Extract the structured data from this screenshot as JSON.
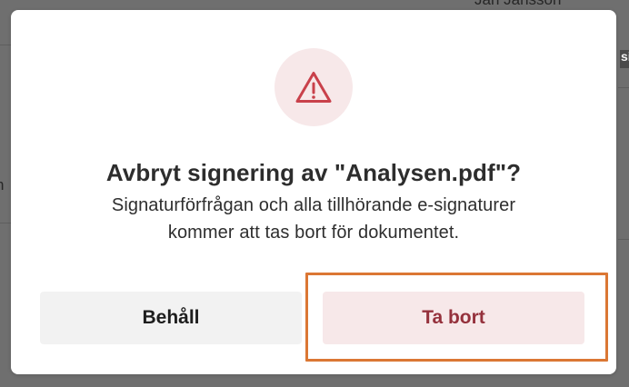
{
  "background": {
    "top_name": "Jan Jansson",
    "right_fragment": "si",
    "left_fragment": "n"
  },
  "dialog": {
    "icon": "warning-triangle-icon",
    "title": "Avbryt signering av \"Analysen.pdf\"?",
    "message": "Signaturförfrågan och alla tillhörande e-signaturer kommer att tas bort för dokumentet.",
    "buttons": {
      "keep_label": "Behåll",
      "remove_label": "Ta bort"
    }
  },
  "colors": {
    "overlay": "#6f6f6f",
    "dialog_background": "#ffffff",
    "warning_background": "#f7e8e9",
    "warning_icon": "#c9414b",
    "danger_text": "#95313c",
    "secondary_button": "#f2f2f2",
    "focus_outline": "#db7734"
  }
}
